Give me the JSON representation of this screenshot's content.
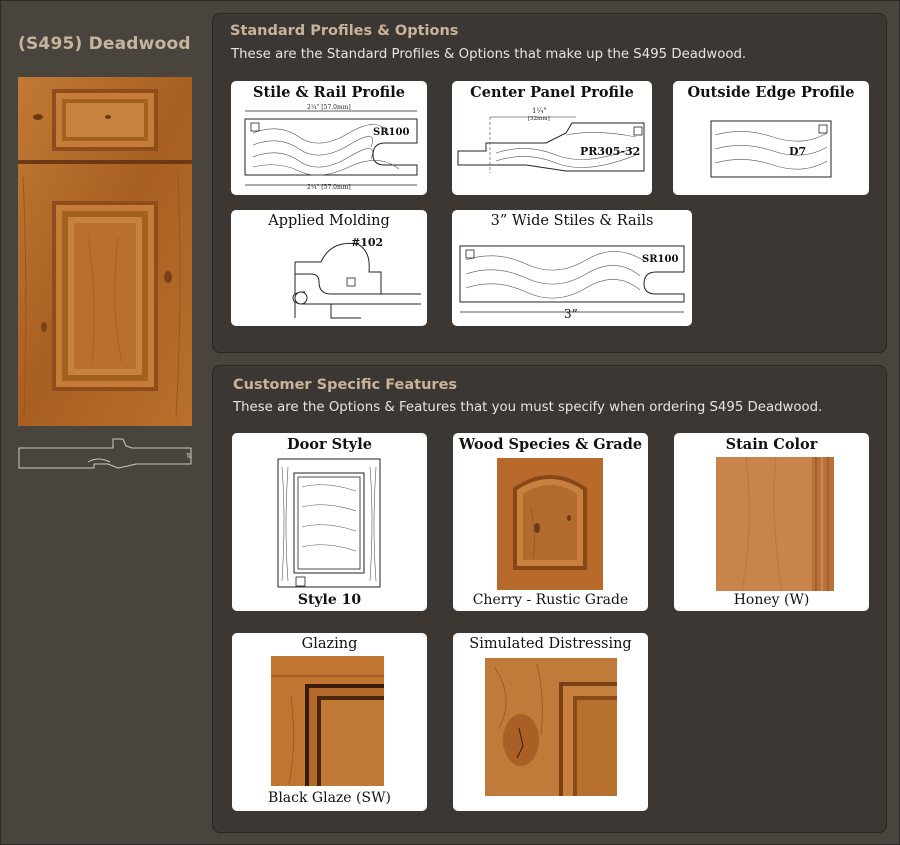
{
  "product": {
    "title": "(S495) Deadwood"
  },
  "standard": {
    "title": "Standard Profiles & Options",
    "description": "These are the Standard Profiles & Options that make up the S495 Deadwood.",
    "cards": {
      "stile_rail": {
        "title": "Stile & Rail Profile",
        "code": "SR100",
        "dim_top": "2¼\" [57.0mm]",
        "dim_bottom": "2¼\" [57.0mm]"
      },
      "center_panel": {
        "title": "Center Panel Profile",
        "code": "PR305-32",
        "dim_main": "1¼\"",
        "dim_sub": "[32mm]"
      },
      "outside_edge": {
        "title": "Outside Edge Profile",
        "code": "D7"
      },
      "applied_molding": {
        "title": "Applied Molding",
        "code": "#102"
      },
      "wide_stiles": {
        "title": "3” Wide Stiles & Rails",
        "code": "SR100",
        "dim": "3”"
      }
    }
  },
  "customer": {
    "title": "Customer Specific Features",
    "description": "These are the Options & Features that you must specify when ordering S495 Deadwood.",
    "cards": {
      "door_style": {
        "title": "Door Style",
        "caption": "Style 10"
      },
      "wood_species": {
        "title": "Wood Species & Grade",
        "caption": "Cherry - Rustic Grade"
      },
      "stain_color": {
        "title": "Stain Color",
        "caption": "Honey (W)"
      },
      "glazing": {
        "title": "Glazing",
        "caption": "Black Glaze (SW)"
      },
      "distressing": {
        "title": "Simulated Distressing"
      }
    }
  },
  "colors": {
    "page_bg": "#4a443f",
    "panel_bg": "#3d3733",
    "heading": "#c6b49b",
    "wood_honey": "#c8844a",
    "wood_cherry": "#b5672a"
  }
}
